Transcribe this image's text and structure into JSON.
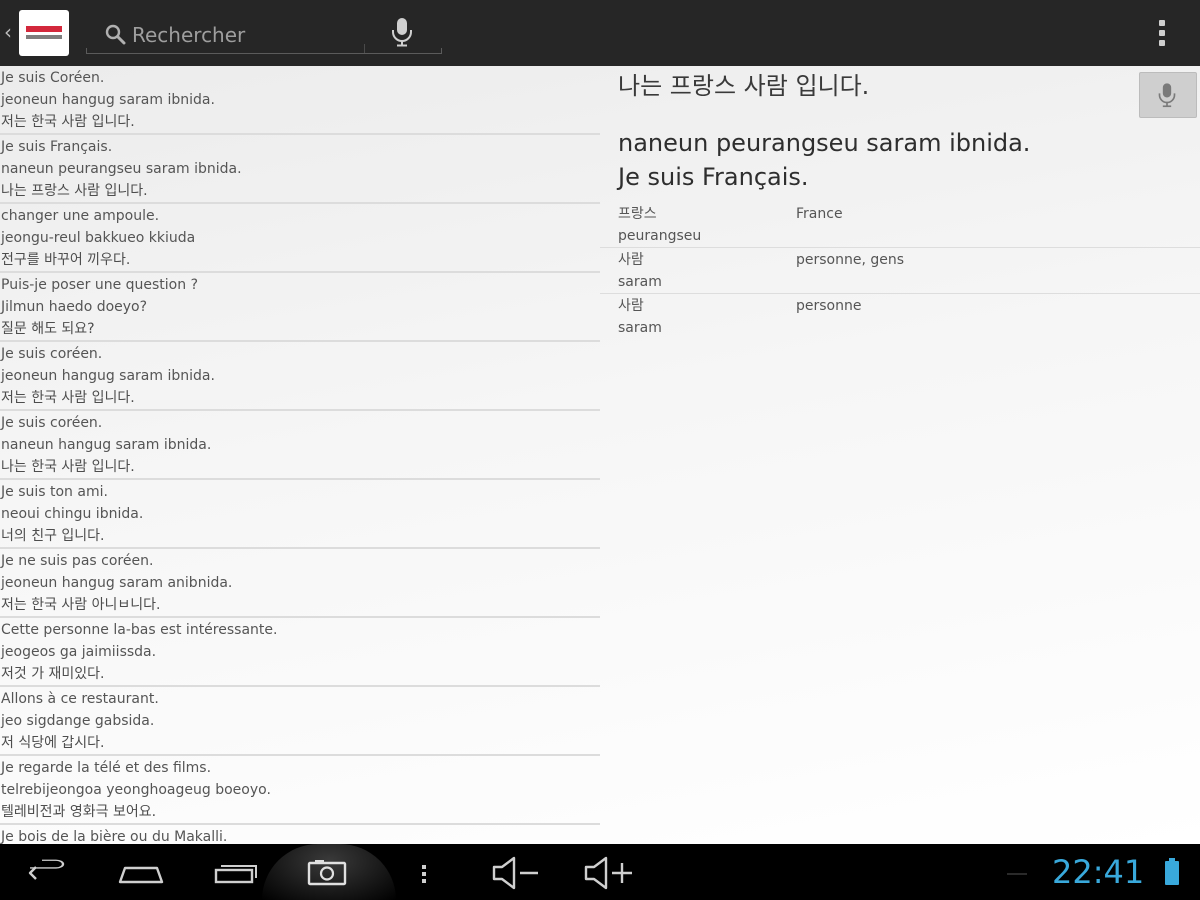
{
  "actionbar": {
    "up_glyph": "‹",
    "search_placeholder": "Rechercher"
  },
  "phrases": [
    {
      "fr": "Je suis Coréen.",
      "roman": "jeoneun hangug saram ibnida.",
      "ko": "저는 한국 사람 입니다."
    },
    {
      "fr": "Je suis Français.",
      "roman": "naneun peurangseu saram ibnida.",
      "ko": "나는 프랑스 사람 입니다."
    },
    {
      "fr": "changer une ampoule.",
      "roman": "jeongu-reul bakkueo kkiuda",
      "ko": "전구를 바꾸어 끼우다."
    },
    {
      "fr": "Puis-je poser une question ?",
      "roman": "Jilmun haedo doeyo?",
      "ko": "질문 해도 되요?"
    },
    {
      "fr": "Je suis coréen.",
      "roman": "jeoneun hangug saram ibnida.",
      "ko": "저는 한국 사람 입니다."
    },
    {
      "fr": "Je suis coréen.",
      "roman": "naneun hangug saram ibnida.",
      "ko": "나는 한국 사람 입니다."
    },
    {
      "fr": "Je suis ton ami.",
      "roman": "neoui chingu ibnida.",
      "ko": "너의 친구 입니다."
    },
    {
      "fr": "Je ne suis pas coréen.",
      "roman": "jeoneun hangug saram anibnida.",
      "ko": "저는 한국 사람 아니ㅂ니다."
    },
    {
      "fr": "Cette personne la-bas est intéressante.",
      "roman": "jeogeos ga jaimiissda.",
      "ko": "저것 가 재미있다."
    },
    {
      "fr": "Allons à ce restaurant.",
      "roman": "jeo sigdange gabsida.",
      "ko": "저 식당에 갑시다."
    },
    {
      "fr": "Je regarde la télé et des films.",
      "roman": "telrebijeongoa yeonghoageug boeoyo.",
      "ko": "텔레비전과 영화극 보어요."
    },
    {
      "fr": "Je bois de la bière ou du Makalli.",
      "roman": "",
      "ko": ""
    }
  ],
  "detail": {
    "korean": "나는 프랑스 사람 입니다.",
    "romanization": "naneun peurangseu saram ibnida.",
    "french": "Je suis Français.",
    "vocab": [
      {
        "word": "프랑스",
        "roman": "peurangseu",
        "meaning": "France"
      },
      {
        "word": "사람",
        "roman": "saram",
        "meaning": "personne, gens"
      },
      {
        "word": "사람",
        "roman": "saram",
        "meaning": "personne"
      }
    ]
  },
  "systembar": {
    "clock": "22:41",
    "clock_color": "#39a9dc"
  },
  "colors": {
    "actionbar": "#262626",
    "logo_red": "#d3283c"
  }
}
